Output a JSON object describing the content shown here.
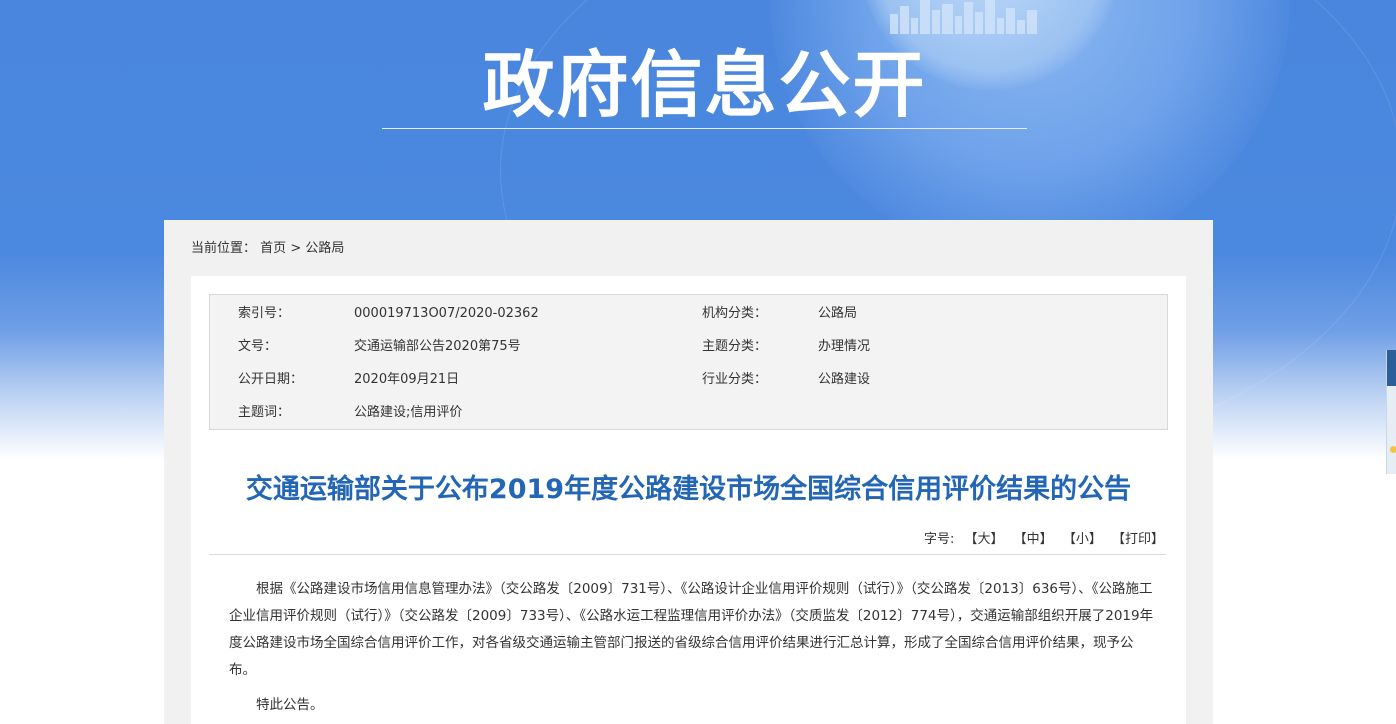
{
  "header": {
    "site_title": "政府信息公开"
  },
  "breadcrumb": {
    "prefix": "当前位置：",
    "home": "首页",
    "separator": ">",
    "current": "公路局"
  },
  "meta": {
    "index_label": "索引号：",
    "index_value": "000019713O07/2020-02362",
    "org_label": "机构分类：",
    "org_value": "公路局",
    "docno_label": "文号：",
    "docno_value": "交通运输部公告2020第75号",
    "topic_label": "主题分类：",
    "topic_value": "办理情况",
    "date_label": "公开日期：",
    "date_value": "2020年09月21日",
    "industry_label": "行业分类：",
    "industry_value": "公路建设",
    "keywords_label": "主题词：",
    "keywords_value": "公路建设;信用评价"
  },
  "article": {
    "title": "交通运输部关于公布2019年度公路建设市场全国综合信用评价结果的公告",
    "paragraph1": "根据《公路建设市场信用信息管理办法》（交公路发〔2009〕731号）、《公路设计企业信用评价规则（试行）》（交公路发〔2013〕636号）、《公路施工企业信用评价规则（试行）》（交公路发〔2009〕733号）、《公路水运工程监理信用评价办法》（交质监发〔2012〕774号），交通运输部组织开展了2019年度公路建设市场全国综合信用评价工作，对各省级交通运输主管部门报送的省级综合信用评价结果进行汇总计算，形成了全国综合信用评价结果，现予公布。",
    "paragraph2": "特此公告。"
  },
  "font_controls": {
    "label": "字号:",
    "large": "【大】",
    "medium": "【中】",
    "small": "【小】",
    "print": "【打印】"
  },
  "colors": {
    "banner_blue": "#4a86dd",
    "title_blue": "#2266b5"
  }
}
